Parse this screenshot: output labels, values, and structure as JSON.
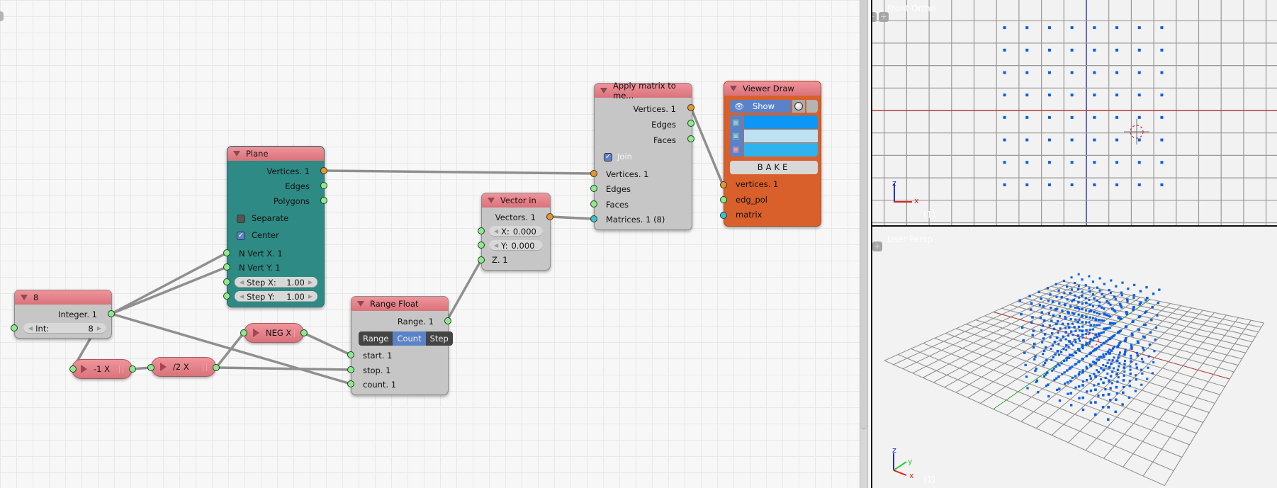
{
  "node_editor": {
    "nodes": {
      "integer": {
        "title": "8",
        "output": "Integer. 1",
        "int_label": "Int:",
        "int_value": "8"
      },
      "neg1x": {
        "title": "-1 X"
      },
      "div2x": {
        "title": "/2 X"
      },
      "negx": {
        "title": "NEG X"
      },
      "plane": {
        "title": "Plane",
        "outputs": [
          "Vertices. 1",
          "Edges",
          "Polygons"
        ],
        "separate_label": "Separate",
        "separate_checked": false,
        "center_label": "Center",
        "center_checked": true,
        "inputs": [
          "N Vert X. 1",
          "N Vert Y. 1"
        ],
        "step_x_label": "Step X:",
        "step_x_value": "1.00",
        "step_y_label": "Step Y:",
        "step_y_value": "1.00"
      },
      "range_float": {
        "title": "Range Float",
        "output": "Range. 1",
        "modes": [
          "Range",
          "Count",
          "Step"
        ],
        "active_mode": "Count",
        "inputs": [
          "start. 1",
          "stop. 1",
          "count. 1"
        ]
      },
      "vector_in": {
        "title": "Vector in",
        "output": "Vectors. 1",
        "x_label": "X:",
        "x_value": "0.000",
        "y_label": "Y:",
        "y_value": "0.000",
        "z_input": "Z. 1"
      },
      "apply_matrix": {
        "title": "Apply matrix to me...",
        "outputs": [
          "Vertices. 1",
          "Edges",
          "Faces"
        ],
        "join_label": "Join",
        "join_checked": true,
        "inputs": [
          "Vertices. 1",
          "Edges",
          "Faces",
          "Matrices. 1 (8)"
        ]
      },
      "viewer_draw": {
        "title": "Viewer Draw",
        "show_label": "Show",
        "vertex_color": "#0c96f5",
        "edge_color": "#bfe2f2",
        "face_color": "#2fb3ef",
        "bake_label": "BAKE",
        "inputs": [
          "vertices. 1",
          "edg_pol",
          "matrix"
        ]
      }
    }
  },
  "viewports": {
    "front": {
      "label": "Front Ortho",
      "frame": "(1)",
      "axis_z": "z",
      "axis_x": "x"
    },
    "persp": {
      "label": "User Persp",
      "frame": "(1)",
      "axis_z": "z",
      "axis_y": "y",
      "axis_x": "x"
    },
    "point_color": "#0a5ee8",
    "grid_points": {
      "count_x": 8,
      "count_y": 8,
      "count_z": 8
    }
  }
}
